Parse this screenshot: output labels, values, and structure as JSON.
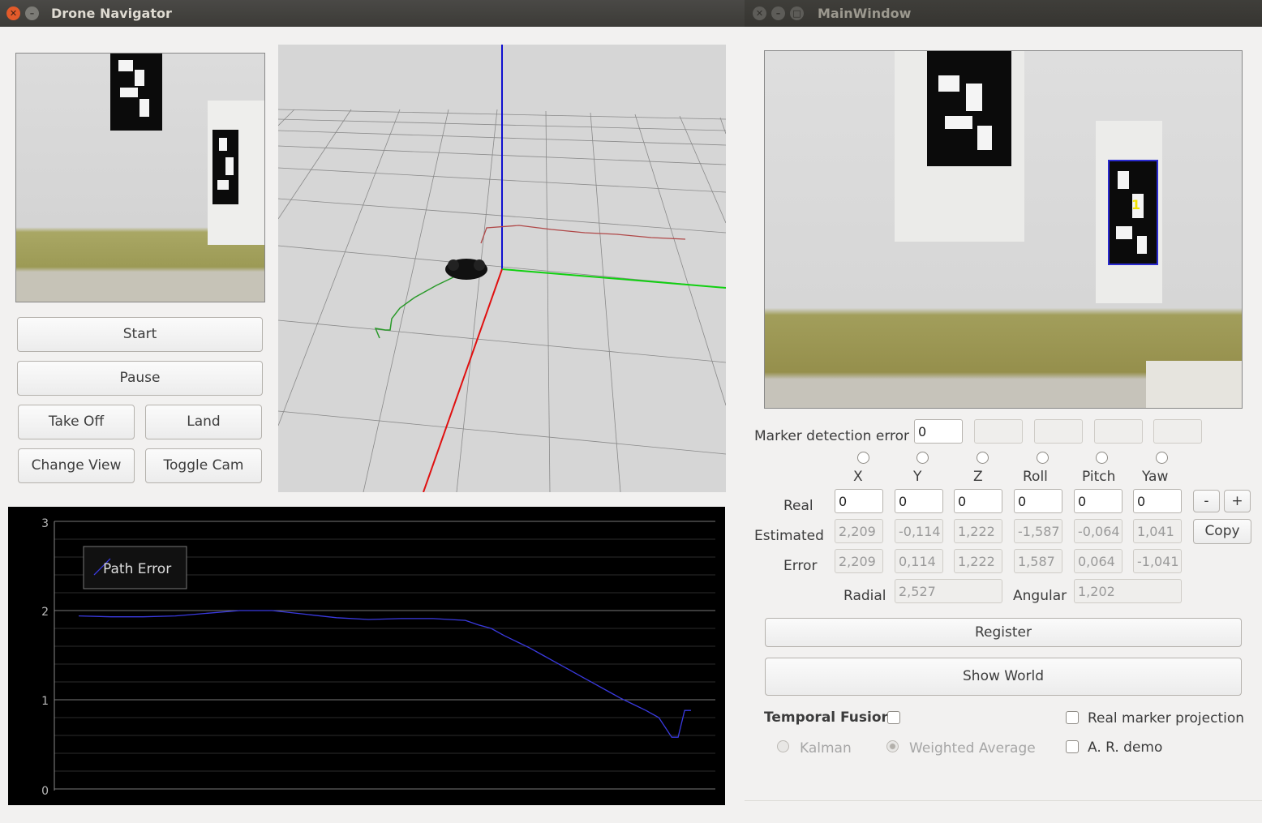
{
  "left_window": {
    "title": "Drone Navigator",
    "buttons": {
      "start": "Start",
      "pause": "Pause",
      "take_off": "Take Off",
      "land": "Land",
      "change_view": "Change View",
      "toggle_cam": "Toggle Cam"
    },
    "plot": {
      "legend": "Path Error",
      "y_ticks": [
        "3",
        "2",
        "1",
        "0"
      ]
    }
  },
  "right_window": {
    "title": "MainWindow",
    "marker_label": "1",
    "marker_detection_label": "Marker detection error",
    "marker_detection_value": "0",
    "columns": [
      "X",
      "Y",
      "Z",
      "Roll",
      "Pitch",
      "Yaw"
    ],
    "row_labels": {
      "real": "Real",
      "estimated": "Estimated",
      "error": "Error"
    },
    "real": [
      "0",
      "0",
      "0",
      "0",
      "0",
      "0"
    ],
    "estimated": [
      "2,209",
      "-0,114",
      "1,222",
      "-1,587",
      "-0,064",
      "1,041"
    ],
    "error": [
      "2,209",
      "0,114",
      "1,222",
      "1,587",
      "0,064",
      "-1,041"
    ],
    "radial_label": "Radial",
    "radial_value": "2,527",
    "angular_label": "Angular",
    "angular_value": "1,202",
    "minus": "-",
    "plus": "+",
    "copy": "Copy",
    "register": "Register",
    "show_world": "Show World",
    "temporal_fusion": "Temporal Fusion",
    "real_marker_projection": "Real marker projection",
    "kalman": "Kalman",
    "weighted_average": "Weighted Average",
    "ar_demo": "A. R. demo"
  },
  "chart_data": {
    "type": "line",
    "legend": "top-left",
    "ylim": [
      0,
      3
    ],
    "y_ticks": [
      0,
      1,
      2,
      3
    ],
    "series": [
      {
        "name": "Path Error",
        "color": "#3a3adf",
        "x": [
          0,
          5,
          10,
          15,
          20,
          25,
          30,
          35,
          40,
          45,
          50,
          55,
          60,
          62,
          64,
          66,
          68,
          70,
          72,
          74,
          76,
          78,
          80,
          82,
          84,
          86,
          88,
          90,
          92,
          93,
          94,
          95
        ],
        "y": [
          1.94,
          1.93,
          1.93,
          1.94,
          1.97,
          2.0,
          2.0,
          1.96,
          1.92,
          1.9,
          1.91,
          1.91,
          1.89,
          1.84,
          1.8,
          1.72,
          1.65,
          1.58,
          1.5,
          1.42,
          1.34,
          1.26,
          1.18,
          1.1,
          1.02,
          0.95,
          0.88,
          0.8,
          0.58,
          0.58,
          0.88,
          0.88
        ]
      }
    ]
  }
}
